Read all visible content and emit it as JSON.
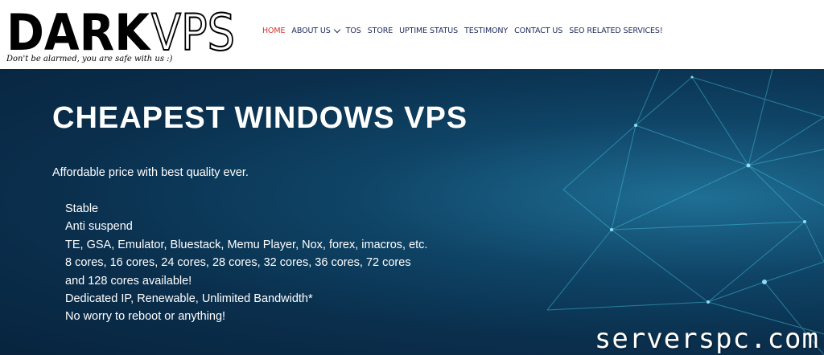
{
  "logo": {
    "text_dark": "DARK",
    "text_vps": "VPS",
    "tagline": "Don't be alarmed, you are safe with us :)"
  },
  "nav": {
    "items": [
      {
        "label": "HOME",
        "active": true
      },
      {
        "label": "ABOUT US",
        "has_dropdown": true
      },
      {
        "label": "TOS"
      },
      {
        "label": "STORE"
      },
      {
        "label": "UPTIME STATUS"
      },
      {
        "label": "TESTIMONY"
      },
      {
        "label": "CONTACT US"
      },
      {
        "label": "SEO RELATED SERVICES!"
      }
    ]
  },
  "hero": {
    "title": "CHEAPEST WINDOWS VPS",
    "subtitle": "Affordable price with best quality ever.",
    "features": [
      "Stable",
      "Anti suspend",
      "TE, GSA, Emulator, Bluestack, Memu Player, Nox, forex, imacros, etc.",
      "8 cores, 16 cores, 24 cores, 28 cores, 32 cores, 36 cores, 72 cores",
      "and 128 cores available!",
      "Dedicated IP, Renewable, Unlimited Bandwidth*",
      "No worry to reboot or anything!"
    ]
  },
  "watermark": "serverspc.com",
  "colors": {
    "nav_text": "#1f2a5a",
    "nav_active": "#d9302c",
    "hero_bg": "#0a2f4d",
    "accent_lines": "#3fb6d6"
  }
}
